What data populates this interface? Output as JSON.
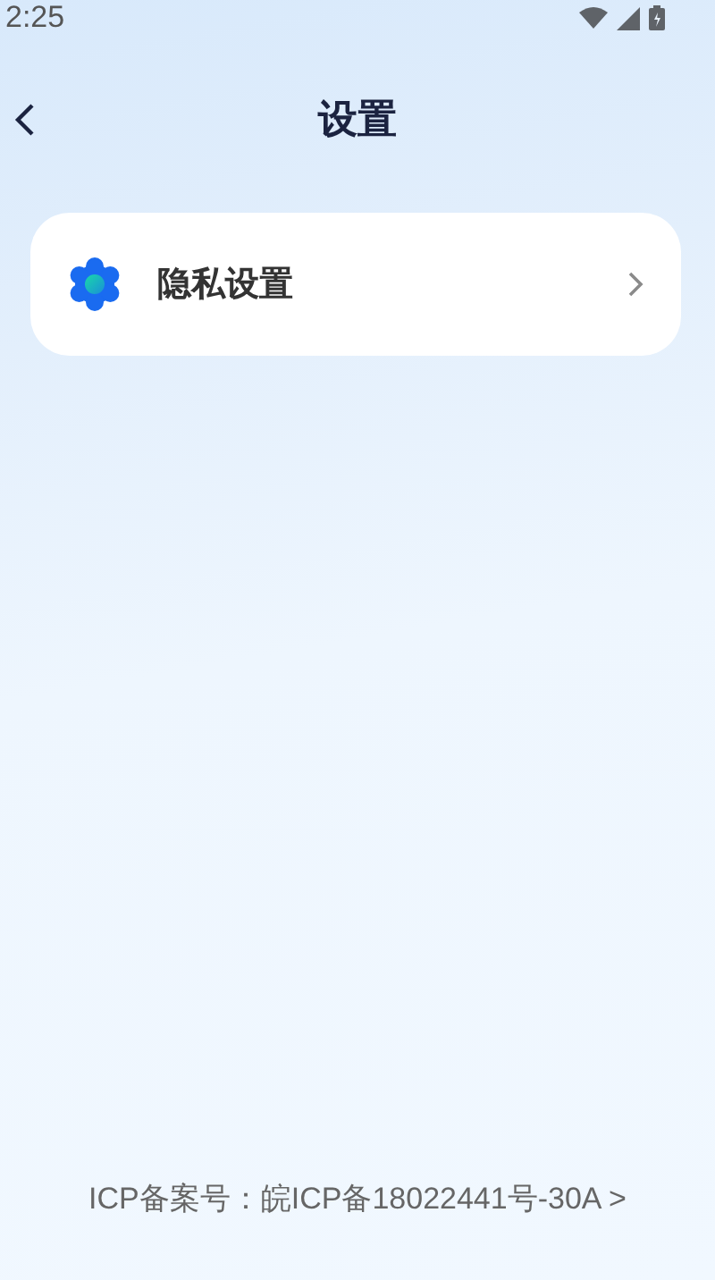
{
  "status_bar": {
    "time": "2:25"
  },
  "header": {
    "title": "设置"
  },
  "menu": [
    {
      "label": "隐私设置"
    }
  ],
  "footer": {
    "icp": "ICP备案号：皖ICP备18022441号-30A >"
  }
}
